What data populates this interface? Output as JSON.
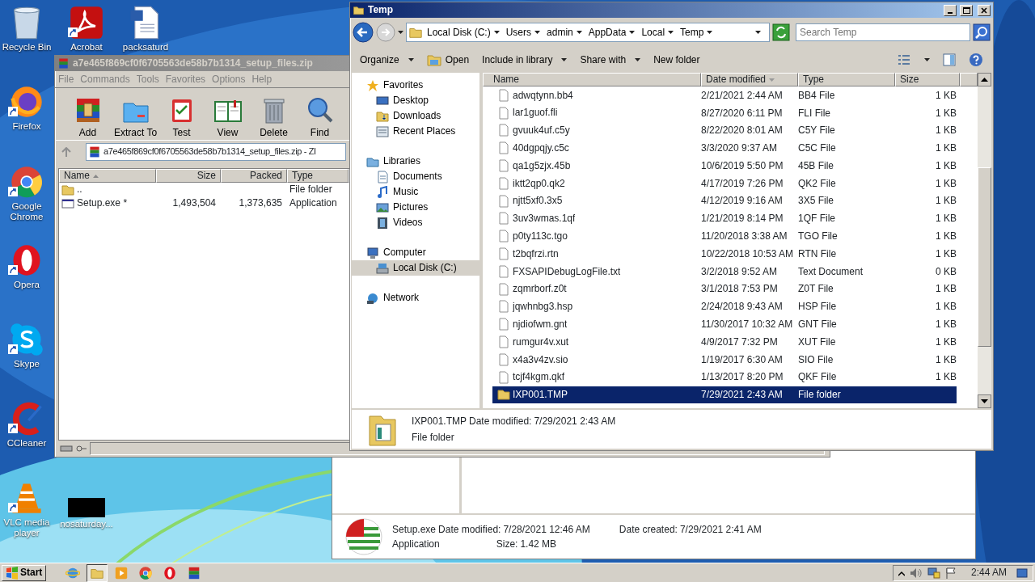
{
  "desktop_icons": [
    {
      "label": "Recycle Bin",
      "kind": "bin",
      "shortcut": false
    },
    {
      "label": "Acrobat",
      "kind": "acrobat",
      "shortcut": true
    },
    {
      "label": "packsaturd",
      "kind": "word",
      "shortcut": false
    },
    {
      "label": "Firefox",
      "kind": "firefox",
      "shortcut": true
    },
    {
      "label": "Google Chrome",
      "kind": "chrome",
      "shortcut": true
    },
    {
      "label": "Opera",
      "kind": "opera",
      "shortcut": true
    },
    {
      "label": "Skype",
      "kind": "skype",
      "shortcut": true
    },
    {
      "label": "CCleaner",
      "kind": "ccleaner",
      "shortcut": true
    },
    {
      "label": "VLC media player",
      "kind": "vlc",
      "shortcut": true
    },
    {
      "label": "nosaturday...",
      "kind": "blank",
      "shortcut": false
    }
  ],
  "archive_window": {
    "title": "a7e465f869cf0f6705563de58b7b1314_setup_files.zip",
    "menu": [
      "File",
      "Commands",
      "Tools",
      "Favorites",
      "Options",
      "Help"
    ],
    "toolbar": [
      {
        "label": "Add",
        "kind": "add"
      },
      {
        "label": "Extract To",
        "kind": "extract"
      },
      {
        "label": "Test",
        "kind": "test"
      },
      {
        "label": "View",
        "kind": "view"
      },
      {
        "label": "Delete",
        "kind": "delete"
      },
      {
        "label": "Find",
        "kind": "find"
      }
    ],
    "path": "a7e465f869cf0f6705563de58b7b1314_setup_files.zip - ZI",
    "columns": [
      {
        "label": "Name",
        "sorted": true
      },
      {
        "label": "Size",
        "sorted": false
      },
      {
        "label": "Packed",
        "sorted": false
      },
      {
        "label": "Type",
        "sorted": false
      }
    ],
    "rows": [
      {
        "name": "..",
        "size": "",
        "packed": "",
        "type": "File folder",
        "kind": "folder"
      },
      {
        "name": "Setup.exe *",
        "size": "1,493,504",
        "packed": "1,373,635",
        "type": "Application",
        "kind": "exe"
      }
    ]
  },
  "explorer_window": {
    "title": "Temp",
    "breadcrumb": [
      "Local Disk (C:)",
      "Users",
      "admin",
      "AppData",
      "Local",
      "Temp"
    ],
    "search": {
      "placeholder": "Search Temp"
    },
    "commands": [
      {
        "label": "Organize",
        "dropdown": true,
        "kind": "plain"
      },
      {
        "label": "Open",
        "dropdown": false,
        "kind": "open"
      },
      {
        "label": "Include in library",
        "dropdown": true,
        "kind": "plain"
      },
      {
        "label": "Share with",
        "dropdown": true,
        "kind": "plain"
      },
      {
        "label": "New folder",
        "dropdown": false,
        "kind": "plain"
      }
    ],
    "nav": [
      {
        "label": "Favorites",
        "kind": "star",
        "selected": false,
        "children": [
          {
            "label": "Desktop",
            "kind": "desktop",
            "selected": false
          },
          {
            "label": "Downloads",
            "kind": "downloads",
            "selected": false
          },
          {
            "label": "Recent Places",
            "kind": "recent",
            "selected": false
          }
        ]
      },
      {
        "label": "Libraries",
        "kind": "library",
        "selected": false,
        "children": [
          {
            "label": "Documents",
            "kind": "documents",
            "selected": false
          },
          {
            "label": "Music",
            "kind": "music",
            "selected": false
          },
          {
            "label": "Pictures",
            "kind": "pictures",
            "selected": false
          },
          {
            "label": "Videos",
            "kind": "videos",
            "selected": false
          }
        ]
      },
      {
        "label": "Computer",
        "kind": "computer",
        "selected": false,
        "children": [
          {
            "label": "Local Disk (C:)",
            "kind": "disk",
            "selected": true
          }
        ]
      },
      {
        "label": "Network",
        "kind": "network",
        "selected": false
      }
    ],
    "columns": [
      {
        "label": "Name",
        "sorted": false
      },
      {
        "label": "Date modified",
        "sorted": true
      },
      {
        "label": "Type",
        "sorted": false
      },
      {
        "label": "Size",
        "sorted": false
      }
    ],
    "rows": [
      {
        "name": "adwqtynn.bb4",
        "date": "2/21/2021 2:44 AM",
        "type": "BB4 File",
        "size": "1 KB",
        "kind": "file",
        "selected": false
      },
      {
        "name": "lar1guof.fli",
        "date": "8/27/2020 6:11 PM",
        "type": "FLI File",
        "size": "1 KB",
        "kind": "file",
        "selected": false
      },
      {
        "name": "gvuuk4uf.c5y",
        "date": "8/22/2020 8:01 AM",
        "type": "C5Y File",
        "size": "1 KB",
        "kind": "file",
        "selected": false
      },
      {
        "name": "40dgpqjy.c5c",
        "date": "3/3/2020 9:37 AM",
        "type": "C5C File",
        "size": "1 KB",
        "kind": "file",
        "selected": false
      },
      {
        "name": "qa1g5zjx.45b",
        "date": "10/6/2019 5:50 PM",
        "type": "45B File",
        "size": "1 KB",
        "kind": "file",
        "selected": false
      },
      {
        "name": "iktt2qp0.qk2",
        "date": "4/17/2019 7:26 PM",
        "type": "QK2 File",
        "size": "1 KB",
        "kind": "file",
        "selected": false
      },
      {
        "name": "njtt5xf0.3x5",
        "date": "4/12/2019 9:16 AM",
        "type": "3X5 File",
        "size": "1 KB",
        "kind": "file",
        "selected": false
      },
      {
        "name": "3uv3wmas.1qf",
        "date": "1/21/2019 8:14 PM",
        "type": "1QF File",
        "size": "1 KB",
        "kind": "file",
        "selected": false
      },
      {
        "name": "p0ty113c.tgo",
        "date": "11/20/2018 3:38 AM",
        "type": "TGO File",
        "size": "1 KB",
        "kind": "file",
        "selected": false
      },
      {
        "name": "t2bqfrzi.rtn",
        "date": "10/22/2018 10:53 AM",
        "type": "RTN File",
        "size": "1 KB",
        "kind": "file",
        "selected": false
      },
      {
        "name": "FXSAPIDebugLogFile.txt",
        "date": "3/2/2018 9:52 AM",
        "type": "Text Document",
        "size": "0 KB",
        "kind": "file",
        "selected": false
      },
      {
        "name": "zqmrborf.z0t",
        "date": "3/1/2018 7:53 PM",
        "type": "Z0T File",
        "size": "1 KB",
        "kind": "file",
        "selected": false
      },
      {
        "name": "jqwhnbg3.hsp",
        "date": "2/24/2018 9:43 AM",
        "type": "HSP File",
        "size": "1 KB",
        "kind": "file",
        "selected": false
      },
      {
        "name": "njdiofwm.gnt",
        "date": "11/30/2017 10:32 AM",
        "type": "GNT File",
        "size": "1 KB",
        "kind": "file",
        "selected": false
      },
      {
        "name": "rumgur4v.xut",
        "date": "4/9/2017 7:32 PM",
        "type": "XUT File",
        "size": "1 KB",
        "kind": "file",
        "selected": false
      },
      {
        "name": "x4a3v4zv.sio",
        "date": "1/19/2017 6:30 AM",
        "type": "SIO File",
        "size": "1 KB",
        "kind": "file",
        "selected": false
      },
      {
        "name": "tcjf4kgm.qkf",
        "date": "1/13/2017 8:20 PM",
        "type": "QKF File",
        "size": "1 KB",
        "kind": "file",
        "selected": false
      },
      {
        "name": "IXP001.TMP",
        "date": "7/29/2021 2:43 AM",
        "type": "File folder",
        "size": "",
        "kind": "folder",
        "selected": true
      }
    ],
    "details": {
      "name": "IXP001.TMP",
      "date_label": "Date modified:",
      "date": "7/29/2021 2:43 AM",
      "type": "File folder"
    }
  },
  "back_window": {
    "details": {
      "name": "Setup.exe",
      "modified_label": "Date modified:",
      "modified": "7/28/2021 12:46 AM",
      "created_label": "Date created:",
      "created": "7/29/2021 2:41 AM",
      "type": "Application",
      "size_label": "Size:",
      "size": "1.42 MB"
    }
  },
  "taskbar": {
    "start": "Start",
    "apps": [
      {
        "kind": "ie",
        "active": false
      },
      {
        "kind": "explorer",
        "active": true
      },
      {
        "kind": "media",
        "active": false
      },
      {
        "kind": "chrome",
        "active": false
      },
      {
        "kind": "opera",
        "active": false
      },
      {
        "kind": "winrar",
        "active": false
      }
    ],
    "clock": "2:44 AM"
  }
}
